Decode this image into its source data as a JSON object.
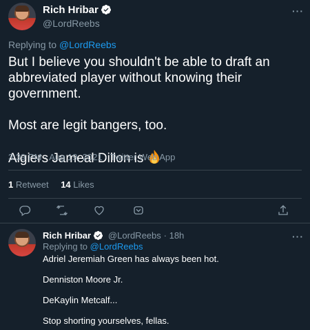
{
  "main_tweet": {
    "author_name": "Rich Hribar",
    "author_handle": "@LordReebs",
    "replying_prefix": "Replying to ",
    "replying_handle": "@LordReebs",
    "paragraphs": [
      "But I believe you shouldn't be able to draft an abbreviated player without knowing their government.",
      "Most are legit bangers, too.",
      "Algiers Jameal Dillon is"
    ],
    "emoji": "fire",
    "timestamp": "3:39 PM · Aug 19, 2021 · Twitter Web App",
    "retweet_count": "1",
    "retweet_label": "Retweet",
    "like_count": "14",
    "like_label": "Likes"
  },
  "reply_tweet": {
    "author_name": "Rich Hribar",
    "author_handle": "@LordReebs",
    "time": "· 18h",
    "replying_prefix": "Replying to ",
    "replying_handle": "@LordReebs",
    "lines": [
      "Adriel Jeremiah Green has always been hot.",
      "Denniston Moore Jr.",
      "DeKaylin Metcalf...",
      "Stop shorting yourselves, fellas."
    ]
  },
  "more_label": "···",
  "colors": {
    "background": "#15202b",
    "accent": "#1d9bf0",
    "muted": "#8899a6",
    "divider": "#38444d"
  }
}
